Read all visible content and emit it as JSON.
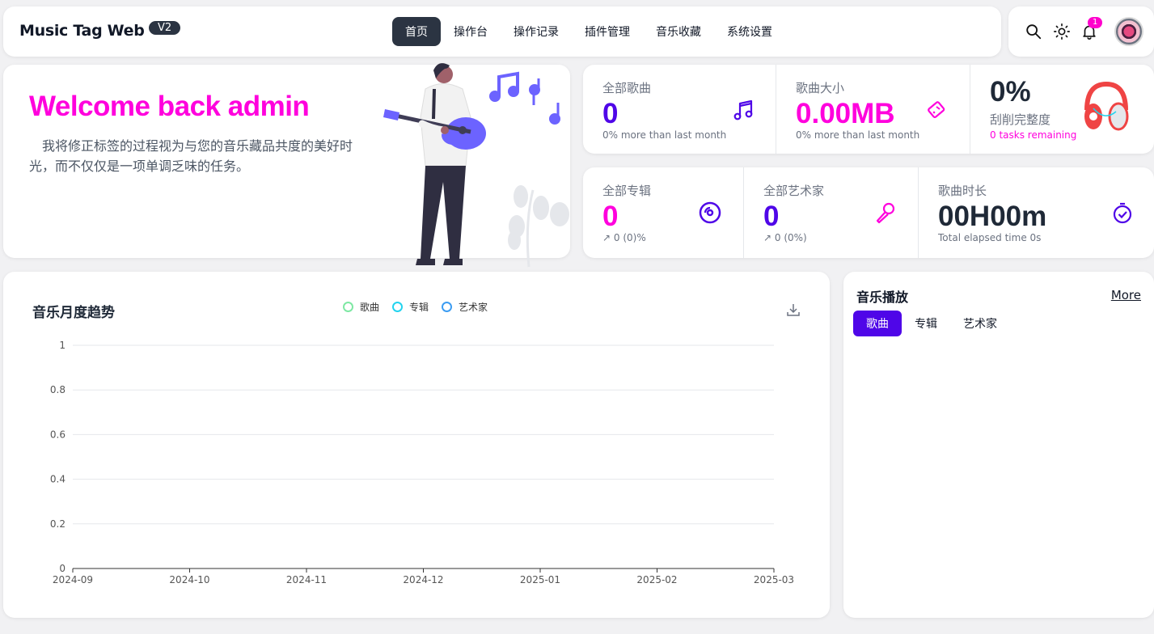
{
  "header": {
    "brand": "Music Tag Web",
    "version": "V2",
    "nav": [
      "首页",
      "操作台",
      "操作记录",
      "插件管理",
      "音乐收藏",
      "系统设置"
    ],
    "notification_count": "1"
  },
  "welcome": {
    "title": "Welcome back admin",
    "description": "我将修正标签的过程视为与您的音乐藏品共度的美好时光，而不仅仅是一项单调乏味的任务。"
  },
  "stats": {
    "all_songs": {
      "label": "全部歌曲",
      "value": "0",
      "sub": "0% more than last month"
    },
    "song_size": {
      "label": "歌曲大小",
      "value": "0.00MB",
      "sub": "0% more than last month"
    },
    "scrape": {
      "value": "0%",
      "label": "刮削完整度",
      "sub": "0 tasks remaining"
    },
    "all_albums": {
      "label": "全部专辑",
      "value": "0",
      "sub": "↗ 0 (0)%"
    },
    "all_artists": {
      "label": "全部艺术家",
      "value": "0",
      "sub": "↗ 0 (0%)"
    },
    "duration": {
      "label": "歌曲时长",
      "value": "00H00m",
      "sub": "Total elapsed time 0s"
    }
  },
  "chart_card": {
    "title": "音乐月度趋势"
  },
  "chart_data": {
    "type": "line",
    "x": [
      "2024-09",
      "2024-10",
      "2024-11",
      "2024-12",
      "2025-01",
      "2025-02",
      "2025-03"
    ],
    "yticks": [
      "0",
      "0.2",
      "0.4",
      "0.6",
      "0.8",
      "1"
    ],
    "ylim": [
      0,
      1
    ],
    "series": [
      {
        "name": "歌曲",
        "values": [
          0,
          0,
          0,
          0,
          0,
          0,
          0
        ],
        "color": "#7ee8a3"
      },
      {
        "name": "专辑",
        "values": [
          0,
          0,
          0,
          0,
          0,
          0,
          0
        ],
        "color": "#22d3ee"
      },
      {
        "name": "艺术家",
        "values": [
          0,
          0,
          0,
          0,
          0,
          0,
          0
        ],
        "color": "#3b9cf2"
      }
    ],
    "legend": "top-center",
    "grid": true
  },
  "play": {
    "title": "音乐播放",
    "more": "More",
    "tabs": [
      "歌曲",
      "专辑",
      "艺术家"
    ]
  },
  "colors": {
    "accent": "#4f06e8",
    "brand_pink": "#ff00dd",
    "dark": "#2b3442"
  }
}
